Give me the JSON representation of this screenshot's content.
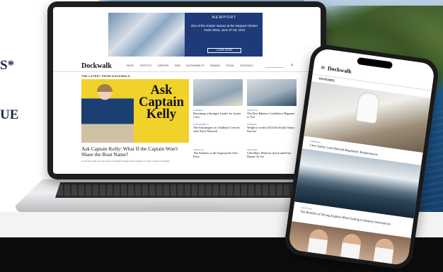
{
  "left_text": {
    "line1": "S*",
    "line2": "UE"
  },
  "ad": {
    "brand": "NEWPORT",
    "copy": "One of the charter season at the Newport Charter Yacht Show, June 27-28, 2023",
    "button": "LEARN MORE"
  },
  "site": {
    "logo": "Dockwalk",
    "nav": [
      "NEWS",
      "LIFESTYLE",
      "CAREERS",
      "JOBS",
      "SUSTAINABILITY",
      "BRANDS",
      "SOCIAL",
      "DOCKWALK"
    ],
    "kicker": "THE LATEST FROM DOCKWALK",
    "feature": {
      "title": "Ask Captain Kelly",
      "headline": "Ask Captain Kelly: What If the Captain Won't Share the Boat Name?",
      "sub": "Is not being told the boat name a red flag? Captain Kelly weighs in on this mysterious situation."
    },
    "cards": [
      {
        "category": "CAREERS",
        "title": "Becoming a Stronger Leader for Junior Crew"
      },
      {
        "category": "LIFESTYLE",
        "title": "The Fine Balance Confidence Happens to You"
      },
      {
        "category": "SUSTAINABILITY",
        "title": "The Advantages of a Sailboat Crewed with Astro Network"
      },
      {
        "category": "CAREERS",
        "title": "Weigh in on the 2024 Dockwalk Salary Survey!"
      },
      {
        "category": "LIFESTYLE",
        "title": "The Winners of the Superyacht Chef Prize"
      },
      {
        "category": "FEATURES",
        "title": "Chef Marc Wilson's Quick and Easy Dinner To-Go"
      }
    ]
  },
  "phone": {
    "logo": "Dockwalk",
    "kicker": "FEATURES",
    "items": [
      {
        "category": "CAREERS",
        "title": "Crew Safety Goes Beyond Regulatory Requirements"
      },
      {
        "category": "LIFESTYLE",
        "title": "The Benefits of Diving Explore When Sailing to Remote Destinations"
      }
    ]
  },
  "colors": {
    "feature_yellow": "#f1d22b",
    "ad_blue": "#1f3a78",
    "navy_text": "#1b2a49",
    "link_blue": "#3a7bb8"
  }
}
